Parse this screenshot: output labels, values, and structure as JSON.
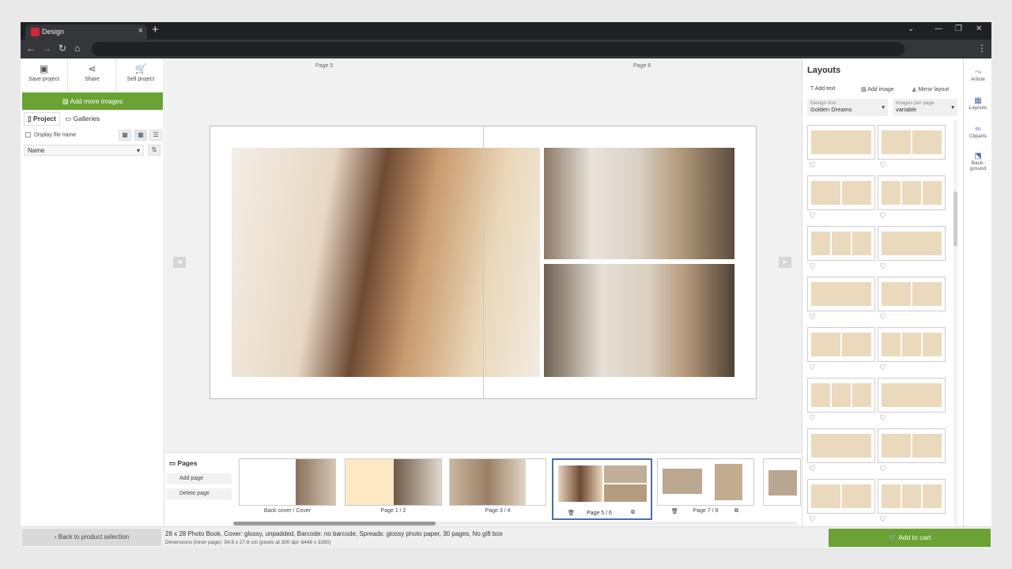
{
  "browser": {
    "tab_title": "Design",
    "new_tab": "+"
  },
  "left": {
    "save": "Save project",
    "share": "Share",
    "sell": "Sell project",
    "add_images": "Add more images",
    "tab_project": "Project",
    "tab_galleries": "Galleries",
    "display_file_name": "Display file name",
    "sort": "Name"
  },
  "canvas": {
    "page_left": "Page 5",
    "page_right": "Page 6"
  },
  "pages": {
    "title": "Pages",
    "add": "Add page",
    "delete": "Delete page",
    "thumbs": [
      {
        "label": "Back cover / Cover"
      },
      {
        "label": "Page 1 / 2"
      },
      {
        "label": "Page 3 / 4"
      },
      {
        "label": "Page 5 / 6"
      },
      {
        "label": "Page 7 / 8"
      }
    ]
  },
  "layouts": {
    "title": "Layouts",
    "add_text": "Add text",
    "add_image": "Add image",
    "mirror": "Mirror layout",
    "design_line_label": "Design line:",
    "design_line_value": "Golden Dreams",
    "ipp_label": "Images per page",
    "ipp_value": "variable"
  },
  "rail": {
    "article": "Article",
    "layouts": "Layouts",
    "cliparts": "Cliparts",
    "background": "Back-",
    "background2": "ground"
  },
  "footer": {
    "back": "Back to product selection",
    "info": "28 x 28 Photo Book, Cover: glossy, unpadded, Barcode: no barcode, Spreads: glossy photo paper, 30 pages, No gift box",
    "dims": "Dimensions (inner page): 54.6 x 27.6 cm (pixels at 300 dpi: 6449 x 3260)",
    "cart": "Add to cart"
  },
  "colors": {
    "accent_green": "#6aa234",
    "chrome_dark": "#1f2023",
    "beige": "#ead9bd"
  }
}
